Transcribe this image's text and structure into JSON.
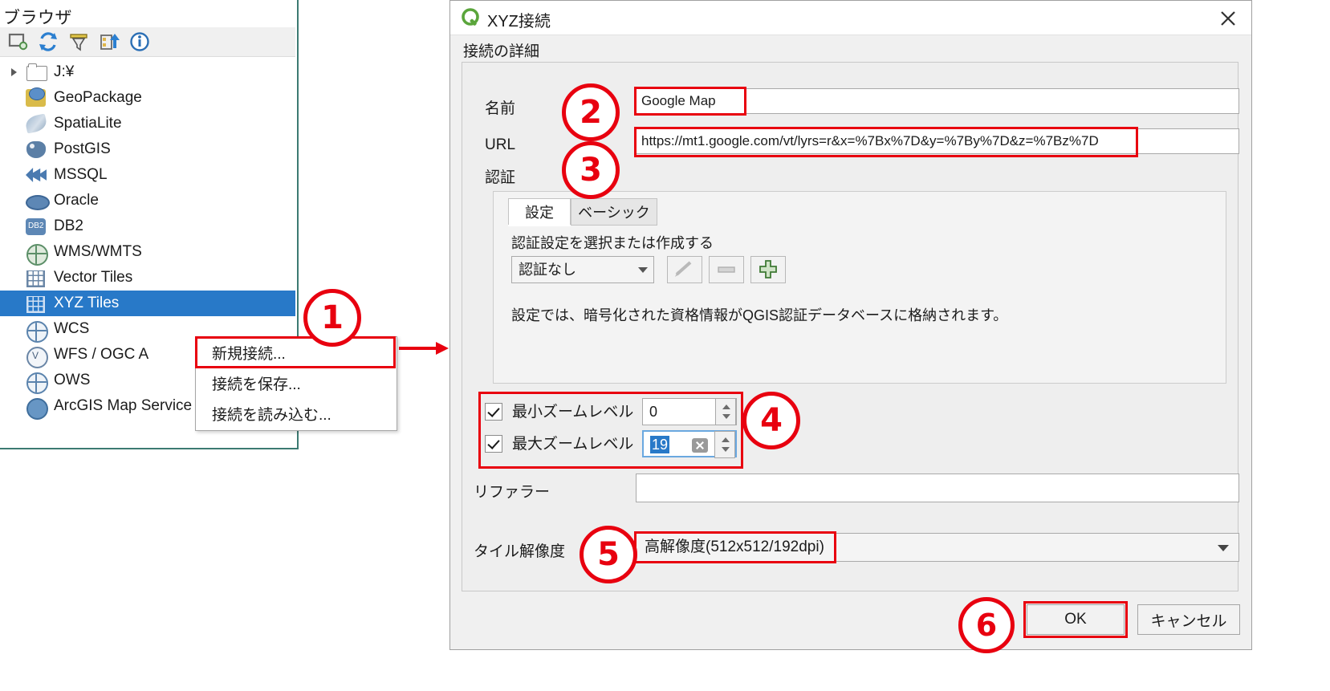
{
  "browser": {
    "title": "ブラウザ",
    "toolbar": [
      {
        "name": "add-layer-icon",
        "tip": "レイヤを追加"
      },
      {
        "name": "refresh-icon",
        "tip": "更新"
      },
      {
        "name": "filter-icon",
        "tip": "フィルタ"
      },
      {
        "name": "collapse-all-icon",
        "tip": "すべて閉じる"
      },
      {
        "name": "properties-info-icon",
        "tip": "情報"
      }
    ],
    "tree": [
      {
        "label": "J:¥",
        "icon": "folder-icon",
        "expandable": true,
        "selected": false
      },
      {
        "label": "GeoPackage",
        "icon": "geopackage-icon",
        "expandable": false,
        "selected": false
      },
      {
        "label": "SpatiaLite",
        "icon": "spatialite-icon",
        "expandable": false,
        "selected": false
      },
      {
        "label": "PostGIS",
        "icon": "postgis-icon",
        "expandable": false,
        "selected": false
      },
      {
        "label": "MSSQL",
        "icon": "mssql-icon",
        "expandable": false,
        "selected": false
      },
      {
        "label": "Oracle",
        "icon": "oracle-icon",
        "expandable": false,
        "selected": false
      },
      {
        "label": "DB2",
        "icon": "db2-icon",
        "expandable": false,
        "selected": false
      },
      {
        "label": "WMS/WMTS",
        "icon": "wms-globe-icon",
        "expandable": false,
        "selected": false
      },
      {
        "label": "Vector Tiles",
        "icon": "vector-tiles-grid-icon",
        "expandable": false,
        "selected": false
      },
      {
        "label": "XYZ Tiles",
        "icon": "xyz-tiles-grid-icon",
        "expandable": false,
        "selected": true
      },
      {
        "label": "WCS",
        "icon": "wcs-globe-icon",
        "expandable": false,
        "selected": false
      },
      {
        "label": "WFS / OGC A",
        "icon": "wfs-globe-icon",
        "expandable": false,
        "selected": false
      },
      {
        "label": "OWS",
        "icon": "ows-globe-icon",
        "expandable": false,
        "selected": false
      },
      {
        "label": "ArcGIS Map Service",
        "icon": "arcgis-icon",
        "expandable": false,
        "selected": false
      }
    ]
  },
  "context_menu": {
    "items": [
      {
        "label": "新規接続...",
        "highlighted": true
      },
      {
        "label": "接続を保存...",
        "highlighted": false
      },
      {
        "label": "接続を読み込む...",
        "highlighted": false
      }
    ]
  },
  "dialog": {
    "title": "XYZ接続",
    "logo": "qgis-logo-icon",
    "close_label": "×",
    "section_label": "接続の詳細",
    "name_label": "名前",
    "name_value": "Google Map",
    "url_label": "URL",
    "url_value": "https://mt1.google.com/vt/lyrs=r&x=%7Bx%7D&y=%7By%7D&z=%7Bz%7D",
    "auth_label": "認証",
    "auth": {
      "tab_settings": "設定",
      "tab_basic": "ベーシック",
      "select_label": "認証設定を選択または作成する",
      "combo_value": "認証なし",
      "edit_btn": "edit-pencil-icon",
      "remove_btn": "remove-minus-icon",
      "add_btn": "add-plus-icon",
      "hint": "設定では、暗号化された資格情報がQGIS認証データベースに格納されます。"
    },
    "min_zoom_label": "最小ズームレベル",
    "min_zoom_value": "0",
    "min_zoom_checked": true,
    "max_zoom_label": "最大ズームレベル",
    "max_zoom_value": "19",
    "max_zoom_checked": true,
    "referrer_label": "リファラー",
    "referrer_value": "",
    "tile_res_label": "タイル解像度",
    "tile_res_value": "高解像度(512x512/192dpi)",
    "ok_label": "OK",
    "cancel_label": "キャンセル"
  },
  "annotations": {
    "accent_color": "#e8000f",
    "badges": [
      {
        "n": "1"
      },
      {
        "n": "2"
      },
      {
        "n": "3"
      },
      {
        "n": "4"
      },
      {
        "n": "5"
      },
      {
        "n": "6"
      }
    ]
  }
}
